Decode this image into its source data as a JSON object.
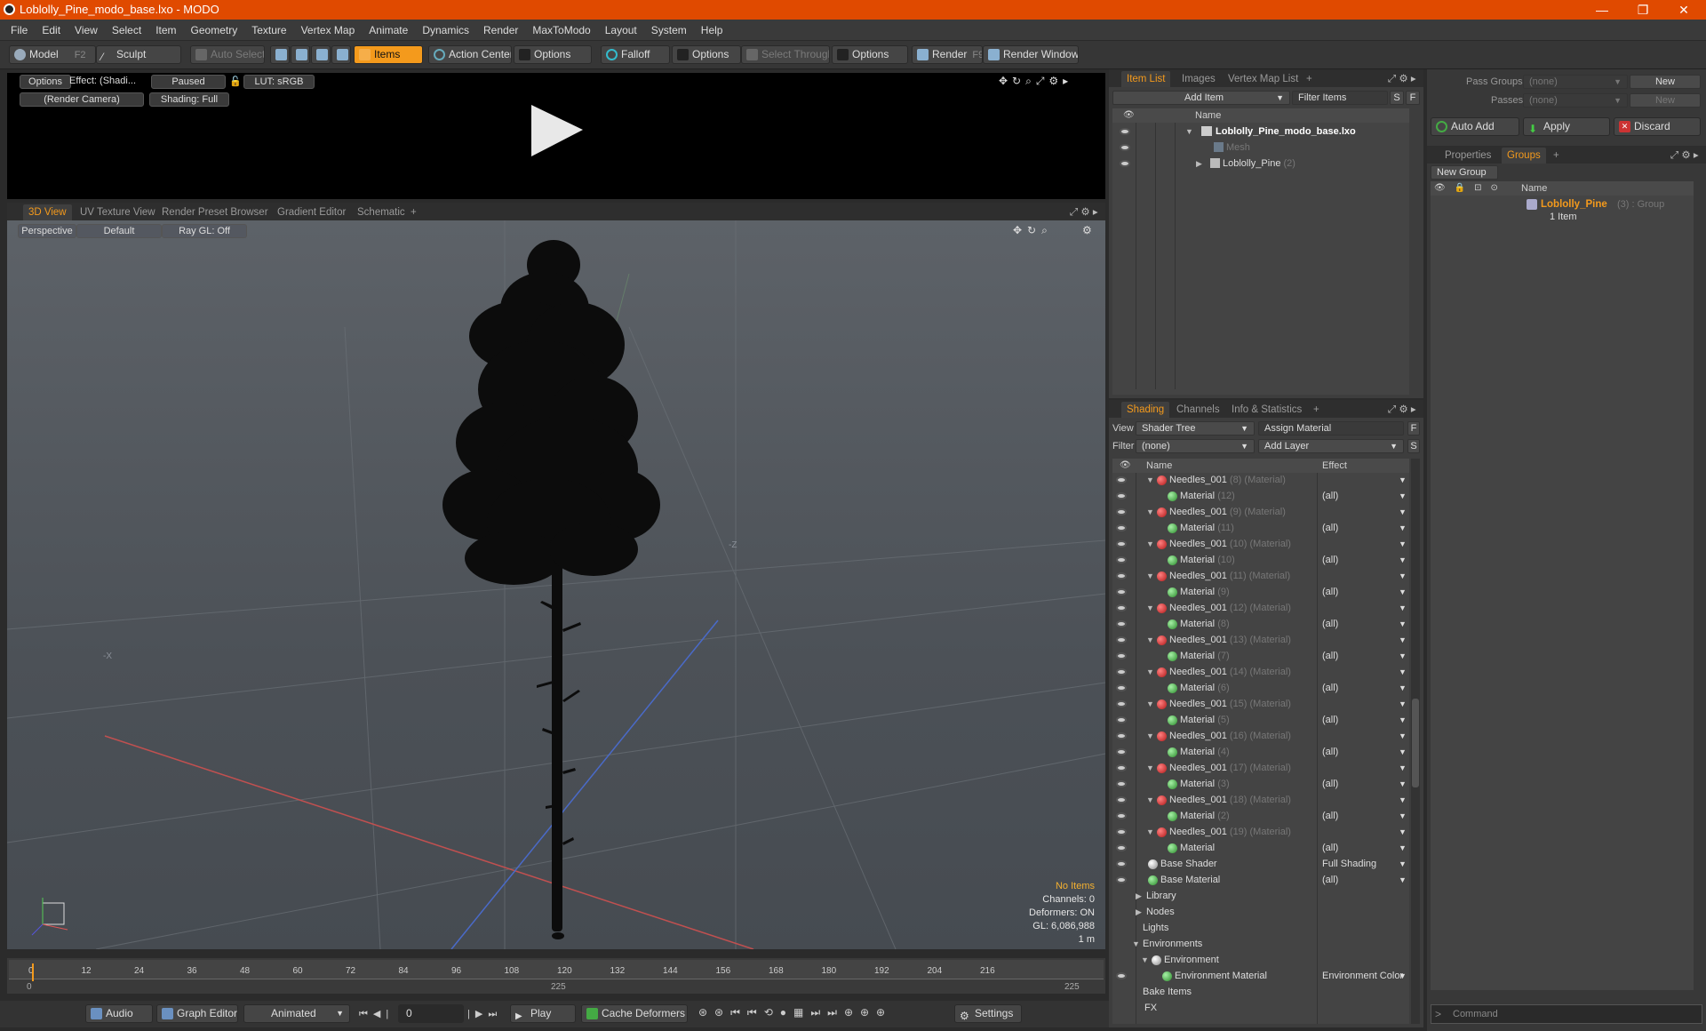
{
  "window": {
    "title": "Loblolly_Pine_modo_base.lxo - MODO",
    "min": "—",
    "max": "❐",
    "close": "✕"
  },
  "menu": [
    "File",
    "Edit",
    "View",
    "Select",
    "Item",
    "Geometry",
    "Texture",
    "Vertex Map",
    "Animate",
    "Dynamics",
    "Render",
    "MaxToModo",
    "Layout",
    "System",
    "Help"
  ],
  "toolbar": {
    "model": "Model",
    "model_key": "F2",
    "sculpt": "Sculpt",
    "auto_select": "Auto Select",
    "items": "Items",
    "action_center": "Action Center",
    "options1": "Options",
    "falloff": "Falloff",
    "options2": "Options",
    "select_through": "Select Through",
    "options3": "Options",
    "render": "Render",
    "render_key": "F9",
    "render_window": "Render Window"
  },
  "render_view": {
    "options": "Options",
    "effect": "Effect: (Shadi...",
    "paused": "Paused",
    "lut": "LUT: sRGB",
    "camera": "(Render Camera)",
    "shading": "Shading: Full"
  },
  "viewport_tabs": [
    "3D View",
    "UV Texture View",
    "Render Preset Browser",
    "Gradient Editor",
    "Schematic"
  ],
  "viewport": {
    "perspective": "Perspective",
    "default": "Default",
    "raygl": "Ray GL: Off",
    "axis_z": "-Z",
    "axis_x": "-X",
    "stats": [
      "No Items",
      "Channels: 0",
      "Deformers: ON",
      "GL: 6,086,988",
      "1 m"
    ]
  },
  "timeline": {
    "ticks": [
      "0",
      "12",
      "24",
      "36",
      "48",
      "60",
      "72",
      "84",
      "96",
      "108",
      "120",
      "132",
      "144",
      "156",
      "168",
      "180",
      "192",
      "204",
      "216"
    ],
    "range_start": "0",
    "range_mid": "225",
    "range_end": "225"
  },
  "bottombar": {
    "audio": "Audio",
    "graph_editor": "Graph Editor",
    "animated": "Animated",
    "frame": "0",
    "play": "Play",
    "cache": "Cache Deformers",
    "settings": "Settings"
  },
  "item_list": {
    "tabs": [
      "Item List",
      "Images",
      "Vertex Map List"
    ],
    "add_item": "Add Item",
    "filter_items": "Filter Items",
    "s": "S",
    "f": "F",
    "col_name": "Name",
    "rows": [
      {
        "name": "Loblolly_Pine_modo_base.lxo",
        "sub": ""
      },
      {
        "name": "Mesh",
        "sub": ""
      },
      {
        "name": "Loblolly_Pine",
        "sub": "(2)"
      }
    ]
  },
  "shading": {
    "tabs": [
      "Shading",
      "Channels",
      "Info & Statistics"
    ],
    "view_label": "View",
    "view_value": "Shader Tree",
    "assign": "Assign Material",
    "f": "F",
    "filter_label": "Filter",
    "filter_value": "(none)",
    "add_layer": "Add Layer",
    "s": "S",
    "col_name": "Name",
    "col_effect": "Effect",
    "rows": [
      {
        "k": "mask",
        "name": "Needles_001",
        "sub": "(8) (Material)",
        "eff": ""
      },
      {
        "k": "mat",
        "name": "Material",
        "sub": "(12)",
        "eff": "(all)"
      },
      {
        "k": "mask",
        "name": "Needles_001",
        "sub": "(9) (Material)",
        "eff": ""
      },
      {
        "k": "mat",
        "name": "Material",
        "sub": "(11)",
        "eff": "(all)"
      },
      {
        "k": "mask",
        "name": "Needles_001",
        "sub": "(10) (Material)",
        "eff": ""
      },
      {
        "k": "mat",
        "name": "Material",
        "sub": "(10)",
        "eff": "(all)"
      },
      {
        "k": "mask",
        "name": "Needles_001",
        "sub": "(11) (Material)",
        "eff": ""
      },
      {
        "k": "mat",
        "name": "Material",
        "sub": "(9)",
        "eff": "(all)"
      },
      {
        "k": "mask",
        "name": "Needles_001",
        "sub": "(12) (Material)",
        "eff": ""
      },
      {
        "k": "mat",
        "name": "Material",
        "sub": "(8)",
        "eff": "(all)"
      },
      {
        "k": "mask",
        "name": "Needles_001",
        "sub": "(13) (Material)",
        "eff": ""
      },
      {
        "k": "mat",
        "name": "Material",
        "sub": "(7)",
        "eff": "(all)"
      },
      {
        "k": "mask",
        "name": "Needles_001",
        "sub": "(14) (Material)",
        "eff": ""
      },
      {
        "k": "mat",
        "name": "Material",
        "sub": "(6)",
        "eff": "(all)"
      },
      {
        "k": "mask",
        "name": "Needles_001",
        "sub": "(15) (Material)",
        "eff": ""
      },
      {
        "k": "mat",
        "name": "Material",
        "sub": "(5)",
        "eff": "(all)"
      },
      {
        "k": "mask",
        "name": "Needles_001",
        "sub": "(16) (Material)",
        "eff": ""
      },
      {
        "k": "mat",
        "name": "Material",
        "sub": "(4)",
        "eff": "(all)"
      },
      {
        "k": "mask",
        "name": "Needles_001",
        "sub": "(17) (Material)",
        "eff": ""
      },
      {
        "k": "mat",
        "name": "Material",
        "sub": "(3)",
        "eff": "(all)"
      },
      {
        "k": "mask",
        "name": "Needles_001",
        "sub": "(18) (Material)",
        "eff": ""
      },
      {
        "k": "mat",
        "name": "Material",
        "sub": "(2)",
        "eff": "(all)"
      },
      {
        "k": "mask",
        "name": "Needles_001",
        "sub": "(19) (Material)",
        "eff": ""
      },
      {
        "k": "mat",
        "name": "Material",
        "sub": "",
        "eff": "(all)"
      },
      {
        "k": "shader",
        "name": "Base Shader",
        "sub": "",
        "eff": "Full Shading"
      },
      {
        "k": "basemat",
        "name": "Base Material",
        "sub": "",
        "eff": "(all)"
      },
      {
        "k": "folder",
        "name": "Library",
        "sub": "",
        "eff": ""
      },
      {
        "k": "folder",
        "name": "Nodes",
        "sub": "",
        "eff": ""
      },
      {
        "k": "plain",
        "name": "Lights",
        "sub": "",
        "eff": ""
      },
      {
        "k": "plain",
        "name": "Environments",
        "sub": "",
        "eff": ""
      },
      {
        "k": "env",
        "name": "Environment",
        "sub": "",
        "eff": ""
      },
      {
        "k": "envmat",
        "name": "Environment Material",
        "sub": "",
        "eff": "Environment Color"
      },
      {
        "k": "plain",
        "name": "Bake Items",
        "sub": "",
        "eff": ""
      },
      {
        "k": "fx",
        "name": "FX",
        "sub": "",
        "eff": ""
      }
    ]
  },
  "right_panel": {
    "pass_groups": "Pass Groups",
    "none1": "(none)",
    "new1": "New",
    "passes": "Passes",
    "none2": "(none)",
    "new2": "New",
    "auto_add": "Auto Add",
    "apply": "Apply",
    "discard": "Discard",
    "tabs": [
      "Properties",
      "Groups"
    ],
    "new_group": "New Group",
    "col_name": "Name",
    "group_name": "Loblolly_Pine",
    "group_sub": "(3) : Group",
    "group_items": "1 Item",
    "command": "Command"
  }
}
